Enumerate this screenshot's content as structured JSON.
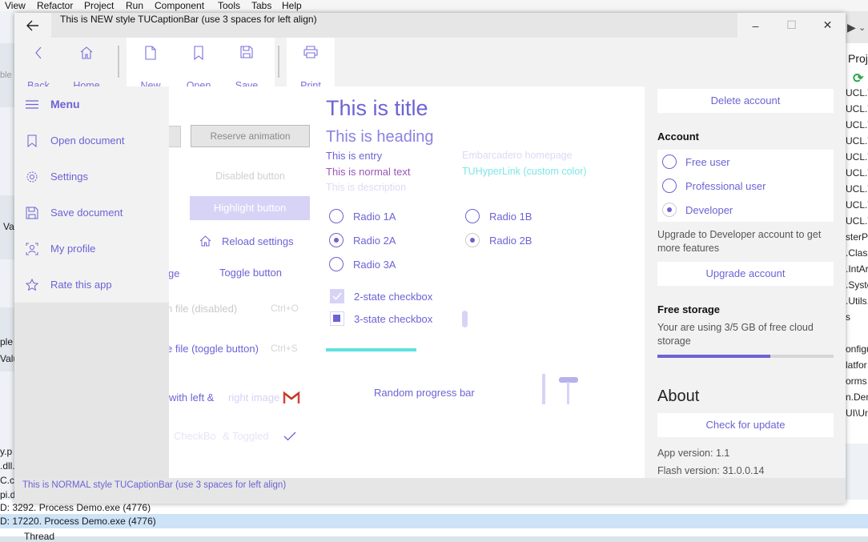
{
  "ide": {
    "menu": [
      "View",
      "Refactor",
      "Project",
      "Run",
      "Component",
      "Tools",
      "Tabs",
      "Help"
    ],
    "right_title": "Proj",
    "right_lines": [
      "UCL.T",
      "UCL.T",
      "UCL.T",
      "UCL.T",
      "UCL.T",
      "UCL.T",
      "UCL.T",
      "UCL.T",
      "UCL.T",
      "sterP",
      ".Class",
      ".IntAr",
      ".Syste",
      ".Utils.",
      "s",
      "",
      "onfigu",
      "latfor",
      "orms",
      "n.Den",
      "UI\\Un"
    ],
    "left_fragments": [
      "ble",
      "Val",
      "ple",
      "Valu",
      "y.p",
      ".dll.",
      "C.c",
      "pi.d"
    ],
    "log_lines": [
      "D: 3292. Process Demo.exe (4776)",
      "D: 17220. Process Demo.exe (4776)",
      "Thread"
    ]
  },
  "caption": {
    "title": "This is NEW style TUCaptionBar (use 3 spaces for left align)",
    "back_icon": "arrow-left-icon",
    "minimize": "–",
    "maximize": "☐",
    "close": "✕"
  },
  "toolbar": {
    "back": "Back",
    "home": "Home",
    "new": "New",
    "open": "Open",
    "save": "Save",
    "print": "Print"
  },
  "sidebar": {
    "menu_label": "Menu",
    "items": [
      {
        "label": "Open document",
        "icon": "document-icon"
      },
      {
        "label": "Settings",
        "icon": "gear-icon"
      },
      {
        "label": "Save document",
        "icon": "floppy-icon"
      },
      {
        "label": "My profile",
        "icon": "profile-icon"
      },
      {
        "label": "Rate this app",
        "icon": "star-icon"
      }
    ]
  },
  "left_column": {
    "reserve_animation": "Reserve animation",
    "disabled_button": "Disabled button",
    "highlight_button": "Highlight button",
    "reload_settings": "Reload settings",
    "fragment_ge": "ge",
    "toggle_button": "Toggle button",
    "open_file_disabled": "n file (disabled)",
    "open_file_shortcut": "Ctrl+O",
    "save_file_toggle": "e file (toggle button)",
    "save_file_shortcut": "Ctrl+S",
    "with_left": "with left & ",
    "right_image": "right image",
    "checkbox_toggled": "CheckBo",
    "checkbox_toggled2": "& Toggled"
  },
  "center": {
    "title": "This is title",
    "heading": "This is heading",
    "entry": "This is entry",
    "normal_text": "This is normal text",
    "description": "This is description",
    "hyperlink_home": "Embarcadero homepage",
    "hyperlink_custom": "TUHyperLink (custom color)",
    "radios": [
      {
        "label": "Radio 1A",
        "checked": false
      },
      {
        "label": "Radio 2A",
        "checked": true
      },
      {
        "label": "Radio 3A",
        "checked": false
      },
      {
        "label": "Radio 1B",
        "checked": false
      },
      {
        "label": "Radio 2B",
        "checked": true
      }
    ],
    "checkbox_2state": "2-state checkbox",
    "checkbox_3state": "3-state checkbox",
    "progress_teal": 0.55,
    "random_progress": "Random progress bar"
  },
  "right": {
    "delete_account": "Delete account",
    "account_head": "Account",
    "account_options": [
      {
        "label": "Free user",
        "checked": false
      },
      {
        "label": "Professional user",
        "checked": false
      },
      {
        "label": "Developer",
        "checked": true
      }
    ],
    "upgrade_text": "Upgrade to Developer account to get more features",
    "upgrade_button": "Upgrade account",
    "storage_head": "Free storage",
    "storage_text": "Your are using 3/5 GB of free cloud storage",
    "storage_progress": 0.64,
    "about_head": "About",
    "check_update": "Check for update",
    "app_version": "App version: 1.1",
    "flash_version": "Flash version: 31.0.0.14"
  },
  "status": {
    "text": "This is NORMAL style TUCaptionBar (use 3 spaces for left align)"
  },
  "colors": {
    "accent": "#6c63d5",
    "teal": "#5ee1e0",
    "highlight_bg": "#d7d3f7"
  }
}
